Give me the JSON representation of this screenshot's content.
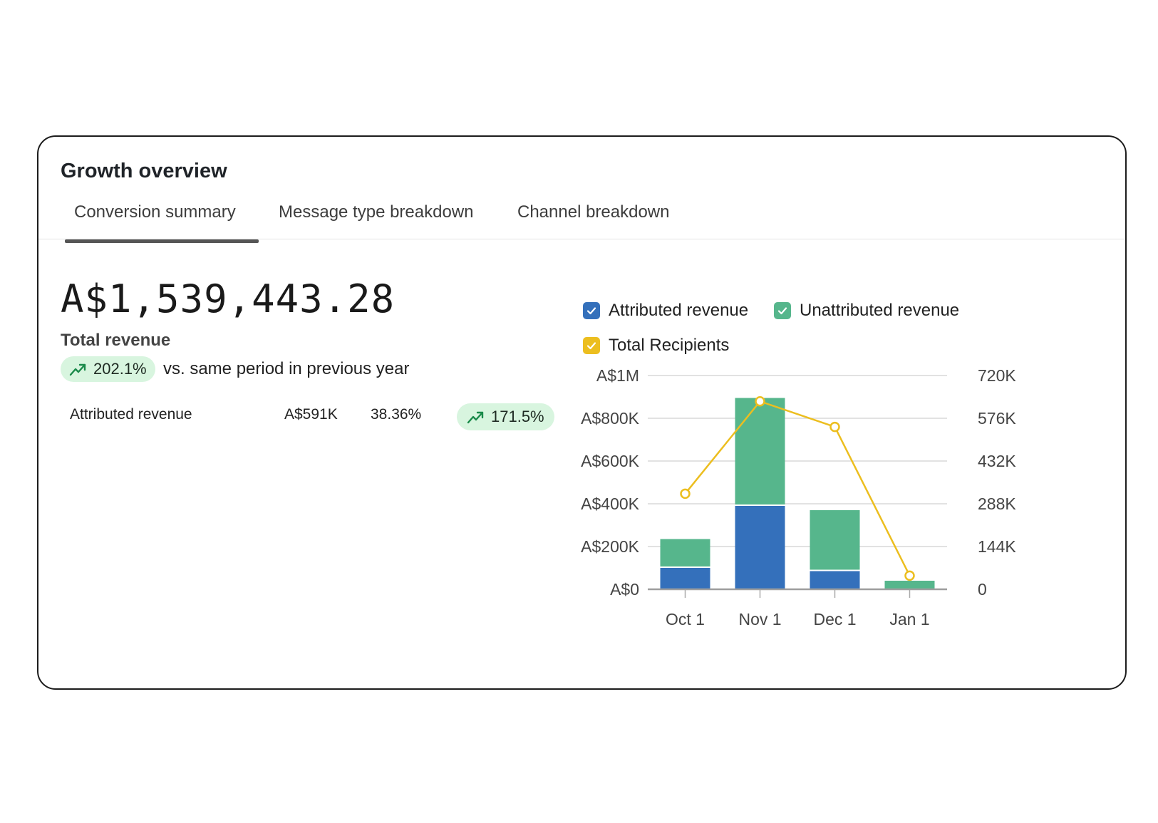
{
  "title": "Growth overview",
  "tabs": [
    {
      "label": "Conversion summary",
      "active": true
    },
    {
      "label": "Message type breakdown",
      "active": false
    },
    {
      "label": "Channel breakdown",
      "active": false
    }
  ],
  "summary": {
    "total_value": "A$1,539,443.28",
    "total_label": "Total revenue",
    "growth_pct": "202.1%",
    "growth_text": "vs. same period in previous year"
  },
  "metrics": [
    {
      "label": "Attributed revenue",
      "value": "A$591K",
      "share": "38.36%",
      "growth": "171.5%"
    }
  ],
  "colors": {
    "attributed": "#3470bb",
    "unattributed": "#56b68c",
    "recipients": "#ecbe1f",
    "pill_bg": "#d8f5df",
    "pill_icon": "#1a8a4a"
  },
  "legend": [
    {
      "label": "Attributed revenue",
      "icon": "check-icon"
    },
    {
      "label": "Unattributed revenue",
      "icon": "check-icon"
    },
    {
      "label": "Total Recipients",
      "icon": "check-icon"
    }
  ],
  "chart_data": {
    "type": "bar",
    "stacked": true,
    "categories": [
      "Oct 1",
      "Nov 1",
      "Dec 1",
      "Jan 1"
    ],
    "series": [
      {
        "name": "Attributed revenue",
        "type": "bar",
        "axis": "left",
        "values": [
          100000,
          390000,
          85000,
          0
        ]
      },
      {
        "name": "Unattributed revenue",
        "type": "bar",
        "axis": "left",
        "values": [
          135000,
          505000,
          285000,
          40000
        ]
      },
      {
        "name": "Total Recipients",
        "type": "line",
        "axis": "right",
        "values": [
          322000,
          633000,
          547000,
          46000
        ]
      }
    ],
    "y_left": {
      "ticks": [
        "A$0",
        "A$200K",
        "A$400K",
        "A$600K",
        "A$800K",
        "A$1M"
      ],
      "range": [
        0,
        1000000
      ]
    },
    "y_right": {
      "ticks": [
        "0",
        "144K",
        "288K",
        "432K",
        "576K",
        "720K"
      ],
      "range": [
        0,
        720000
      ]
    },
    "legend_position": "top",
    "grid": true
  }
}
